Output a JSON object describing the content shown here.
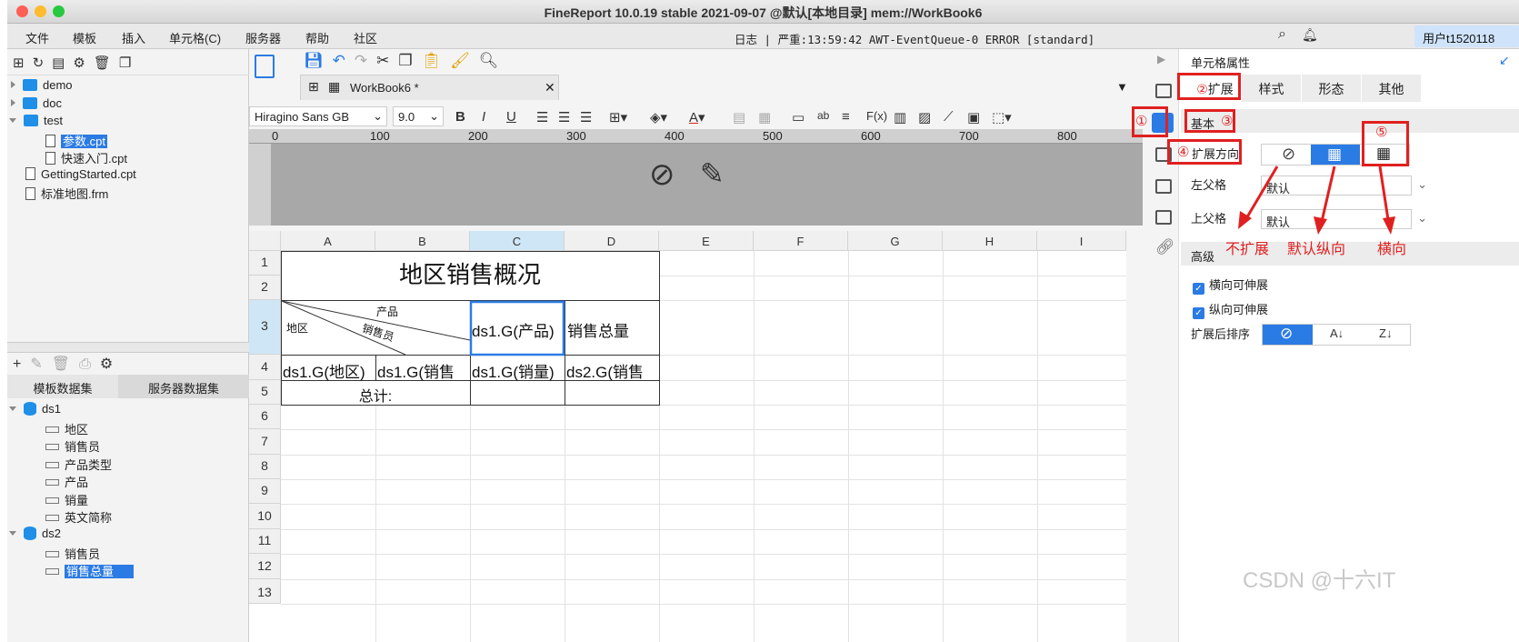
{
  "window": {
    "title": "FineReport 10.0.19 stable 2021-09-07 @默认[本地目录]   mem://WorkBook6"
  },
  "menu": [
    "文件",
    "模板",
    "插入",
    "单元格(C)",
    "服务器",
    "帮助",
    "社区"
  ],
  "log": "日志 | 严重:13:59:42 AWT-EventQueue-0 ERROR [standard]",
  "user": "用户t1520118",
  "tree": {
    "items": [
      "demo",
      "doc",
      "test",
      "参数.cpt",
      "快速入门.cpt",
      "GettingStarted.cpt",
      "标准地图.frm"
    ]
  },
  "dataset_tabs": [
    "模板数据集",
    "服务器数据集"
  ],
  "datasets": {
    "ds1": "ds1",
    "ds1_fields": [
      "地区",
      "销售员",
      "产品类型",
      "产品",
      "销量",
      "英文简称"
    ],
    "ds2": "ds2",
    "ds2_fields": [
      "销售员",
      "销售总量"
    ]
  },
  "file_tab": "WorkBook6 *",
  "font": {
    "name": "Hiragino Sans GB",
    "size": "9.0"
  },
  "ruler": [
    "0",
    "100",
    "200",
    "300",
    "400",
    "500",
    "600",
    "700",
    "800"
  ],
  "columns": [
    "A",
    "B",
    "C",
    "D",
    "E",
    "F",
    "G",
    "H",
    "I"
  ],
  "rows": [
    "1",
    "2",
    "3",
    "4",
    "5",
    "6",
    "7",
    "8",
    "9",
    "10",
    "11",
    "12",
    "13"
  ],
  "cells": {
    "title": "地区销售概况",
    "diag_product": "产品",
    "diag_seller": "销售员",
    "diag_region": "地区",
    "c3": "ds1.G(产品)",
    "d3": "销售总量",
    "a4": "ds1.G(地区)",
    "b4": "ds1.G(销售",
    "c4": "ds1.G(销量)",
    "d4": "ds2.G(销售",
    "total": "总计:"
  },
  "props": {
    "header": "单元格属性",
    "tabs": [
      "扩展",
      "样式",
      "形态",
      "其他"
    ],
    "basic": "基本",
    "expand_dir": "扩展方向",
    "left_parent": "左父格",
    "top_parent": "上父格",
    "default_val": "默认",
    "advanced": "高级",
    "h_stretch": "横向可伸展",
    "v_stretch": "纵向可伸展",
    "sort_after": "扩展后排序"
  },
  "annotations": {
    "n1": "①",
    "n2": "②",
    "n3": "③",
    "n4": "④",
    "n5": "⑤",
    "no_expand": "不扩展",
    "default_vertical": "默认纵向",
    "horizontal": "横向"
  },
  "watermark": "CSDN @十六IT"
}
